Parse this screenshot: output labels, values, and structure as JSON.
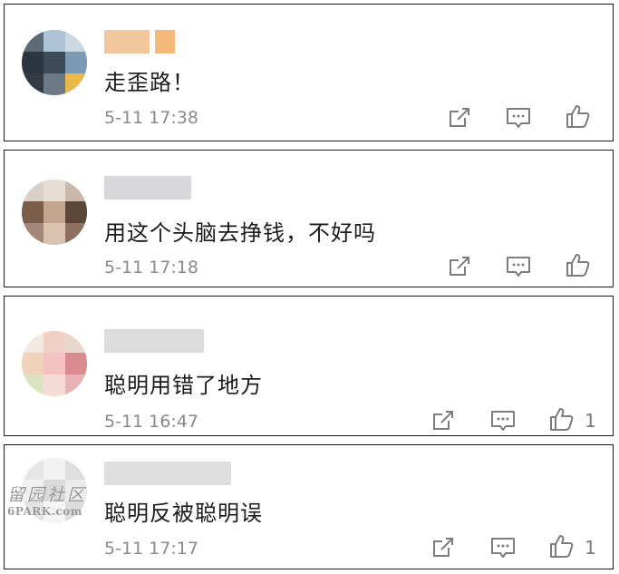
{
  "comments": [
    {
      "text": "走歪路！",
      "time": "5-11 17:38",
      "likes": ""
    },
    {
      "text": "用这个头脑去挣钱，不好吗",
      "time": "5-11 17:18",
      "likes": ""
    },
    {
      "text": "聪明用错了地方",
      "time": "5-11 16:47",
      "likes": "1"
    },
    {
      "text": "聪明反被聪明误",
      "time": "5-11 17:17",
      "likes": "1"
    }
  ],
  "watermark": {
    "cn": "留园社区",
    "en": "6PARK.com"
  },
  "icons": {
    "share": "share-icon",
    "reply": "reply-icon",
    "like": "like-icon"
  }
}
